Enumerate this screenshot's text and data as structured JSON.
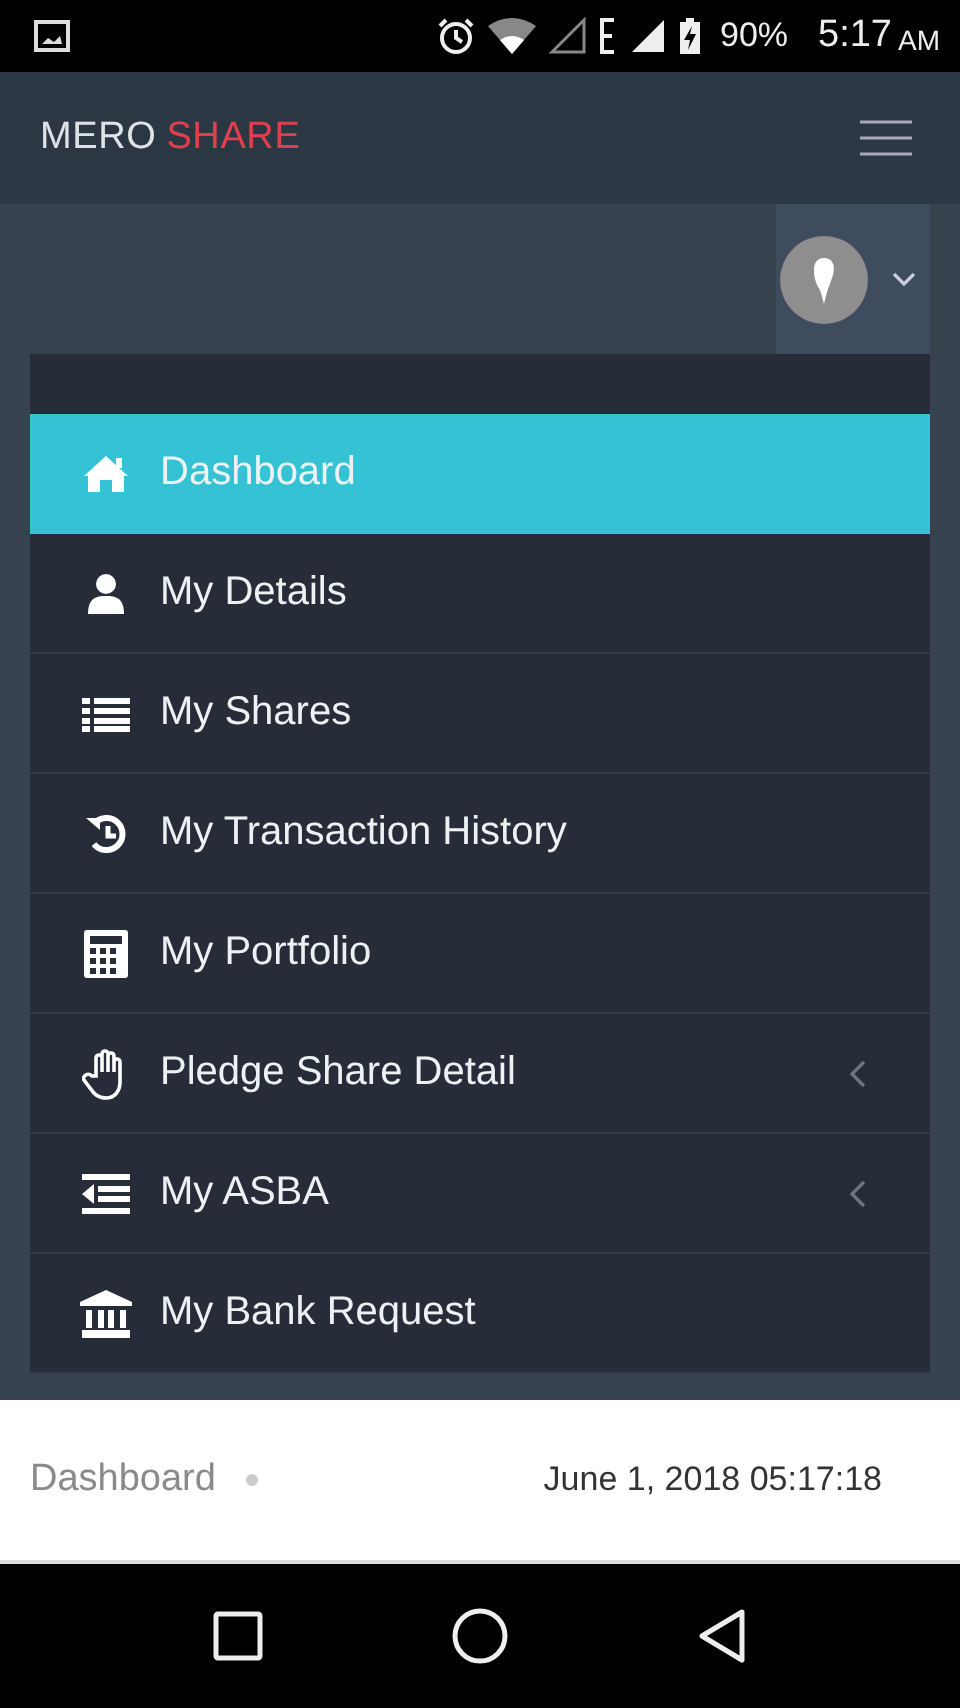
{
  "status_bar": {
    "battery": "90%",
    "time": "5:17",
    "meridiem": "AM"
  },
  "header": {
    "logo_first": "MERO",
    "logo_second": "SHARE"
  },
  "menu": [
    {
      "label": "Dashboard",
      "selected": true,
      "has_submenu": false
    },
    {
      "label": "My Details",
      "selected": false,
      "has_submenu": false
    },
    {
      "label": "My Shares",
      "selected": false,
      "has_submenu": false
    },
    {
      "label": "My Transaction History",
      "selected": false,
      "has_submenu": false
    },
    {
      "label": "My Portfolio",
      "selected": false,
      "has_submenu": false
    },
    {
      "label": "Pledge Share Detail",
      "selected": false,
      "has_submenu": true
    },
    {
      "label": "My ASBA",
      "selected": false,
      "has_submenu": true
    },
    {
      "label": "My Bank Request",
      "selected": false,
      "has_submenu": false
    }
  ],
  "breadcrumb": {
    "page": "Dashboard",
    "datetime": "June 1, 2018 05:17:18"
  }
}
